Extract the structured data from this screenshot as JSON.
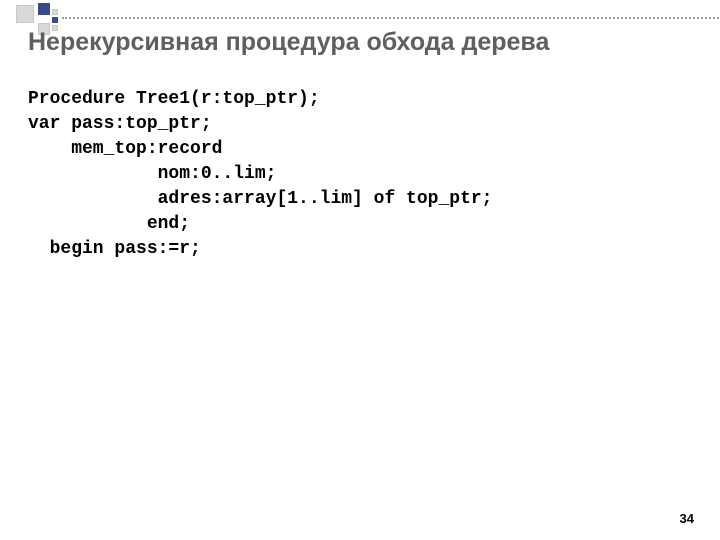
{
  "title": "Нерекурсивная процедура обхода дерева",
  "code": {
    "l1": "Procedure Tree1(r:top_ptr);",
    "l2": "var pass:top_ptr;",
    "l3": "    mem_top:record",
    "l4": "            nom:0..lim;",
    "l5": "            adres:array[1..lim] of top_ptr;",
    "l6": "           end;",
    "l7": "  begin pass:=r;"
  },
  "page": "34"
}
